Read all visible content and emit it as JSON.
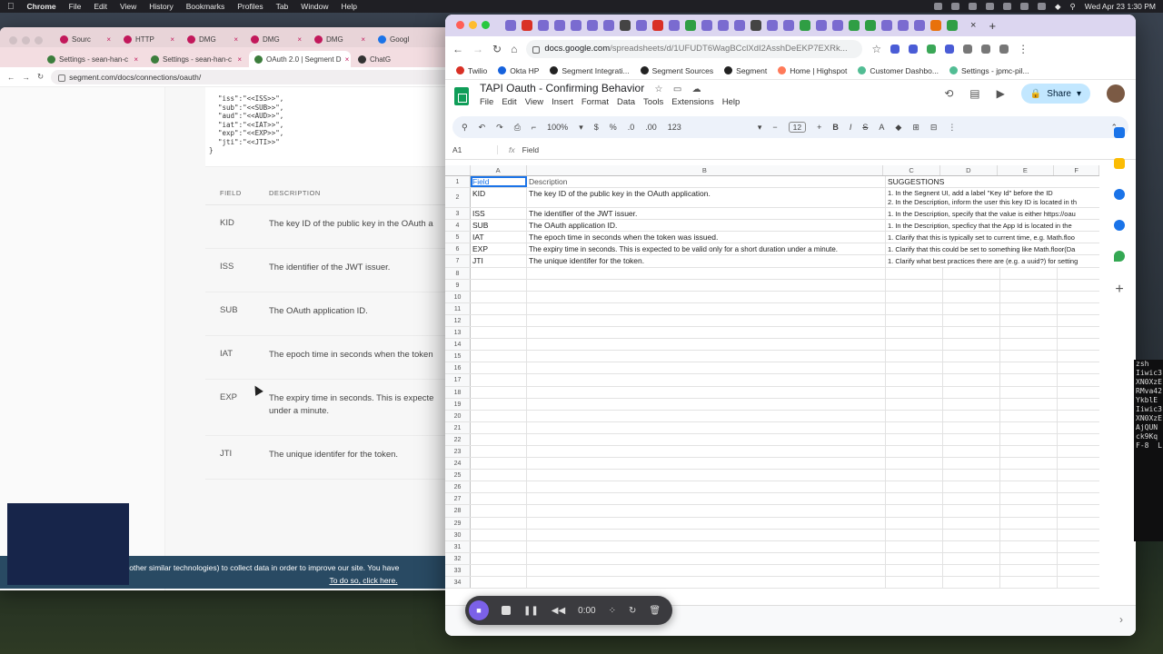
{
  "menubar": {
    "apple": "",
    "items": [
      "Chrome",
      "File",
      "Edit",
      "View",
      "History",
      "Bookmarks",
      "Profiles",
      "Tab",
      "Window",
      "Help"
    ],
    "clock": "Wed Apr 23  1:30 PM"
  },
  "back_window": {
    "tabs_row1": [
      "Sourc",
      "HTTP",
      "DMG",
      "DMG",
      "DMG",
      "Googl"
    ],
    "tabs_row2": [
      "Settings - sean-han-c",
      "Settings - sean-han-c",
      "OAuth 2.0 | Segment D",
      "ChatG"
    ],
    "url": "segment.com/docs/connections/oauth/",
    "code_lines": [
      "\"iss\":\"<<ISS>>\",",
      "\"sub\":\"<<SUB>>\",",
      "\"aud\":\"<<AUD>>\",",
      "\"iat\":\"<<IAT>>\",",
      "\"exp\":\"<<EXP>>\",",
      "\"jti\":\"<<JTI>>\"",
      "}"
    ],
    "table": {
      "headers": [
        "FIELD",
        "DESCRIPTION"
      ],
      "rows": [
        {
          "field": "KID",
          "description": "The key ID of the public key in the OAuth a"
        },
        {
          "field": "ISS",
          "description": "The identifier of the JWT issuer."
        },
        {
          "field": "SUB",
          "description": "The OAuth application ID."
        },
        {
          "field": "IAT",
          "description": "The epoch time in seconds when the token"
        },
        {
          "field": "EXP",
          "description": "The expiry time in seconds. This is expecte",
          "description2": "under a minute."
        },
        {
          "field": "JTI",
          "description": "The unique identifer for the token."
        }
      ]
    },
    "cookie_text": "We use cookies (and other similar technologies) to collect data in order to improve our site. You have",
    "cookie_link": "To do so, click here."
  },
  "front_window": {
    "url_main": "docs.google.com",
    "url_rest": "/spreadsheets/d/1UFUDT6WagBCclXdI2AsshDeEKP7EXRk...",
    "bookmarks": [
      {
        "label": "Twilio",
        "icon": "twilio-icon"
      },
      {
        "label": "Okta HP",
        "icon": "okta-icon"
      },
      {
        "label": "Segment Integrati...",
        "icon": "github-icon"
      },
      {
        "label": "Segment Sources",
        "icon": "github-icon"
      },
      {
        "label": "Segment",
        "icon": "github-icon"
      },
      {
        "label": "Home | Highspot",
        "icon": "highspot-icon"
      },
      {
        "label": "Customer Dashbo...",
        "icon": "segment-icon"
      },
      {
        "label": "Settings - jpmc-pil...",
        "icon": "segment-icon"
      }
    ]
  },
  "sheet": {
    "title": "TAPI Oauth - Confirming Behavior",
    "menu": [
      "File",
      "Edit",
      "View",
      "Insert",
      "Format",
      "Data",
      "Tools",
      "Extensions",
      "Help"
    ],
    "share_label": "Share",
    "zoom": "100%",
    "font_size": "12",
    "toolbar_tokens": [
      "$",
      "%",
      ".0",
      ".00",
      "123"
    ],
    "cell_ref": "A1",
    "formula_value": "Field",
    "columns": [
      "A",
      "B",
      "C",
      "D",
      "E",
      "F"
    ],
    "rows": [
      {
        "n": "1",
        "a": "Field",
        "b": "Description",
        "c": "SUGGESTIONS"
      },
      {
        "n": "2",
        "a": "KID",
        "b": "The key ID of the public key in the OAuth application.",
        "c": "1. In the Segnent UI, add a label \"Key Id\" before the ID",
        "c2": "2. In the Description, inform the user this key ID is located in th"
      },
      {
        "n": "3",
        "a": "ISS",
        "b": "The identifier of the JWT issuer.",
        "c": "1. In the Description, specify that the value is either https://oau"
      },
      {
        "n": "4",
        "a": "SUB",
        "b": "The OAuth application ID.",
        "c": "1. In the Description, specficy that the App Id is located in the"
      },
      {
        "n": "5",
        "a": "IAT",
        "b": "The epoch time in seconds when the token was issued.",
        "c": "1. Clarify that this is typically set to current time, e.g. Math.floo"
      },
      {
        "n": "6",
        "a": "EXP",
        "b": "The expiry time in seconds. This is expected to be valid only for a short duration under a minute.",
        "c": "1. Clarify that this could be set to something like Math.floor(Da"
      },
      {
        "n": "7",
        "a": "JTI",
        "b": "The unique identifer for the token.",
        "c": "1. Clarify what best practices there are (e.g. a uuid?) for setting"
      }
    ],
    "empty_rows_from": 8,
    "empty_rows_to": 34
  },
  "recorder": {
    "time": "0:00"
  },
  "terminal_lines": [
    "zsh",
    "",
    "",
    "",
    "Iiwic3",
    "XN0XzE",
    "RMva42",
    "YkblE",
    "",
    "",
    "Iiwic3",
    "XN0XzE",
    "AjQUN",
    "ck9Kq",
    "",
    "F-8  L"
  ]
}
